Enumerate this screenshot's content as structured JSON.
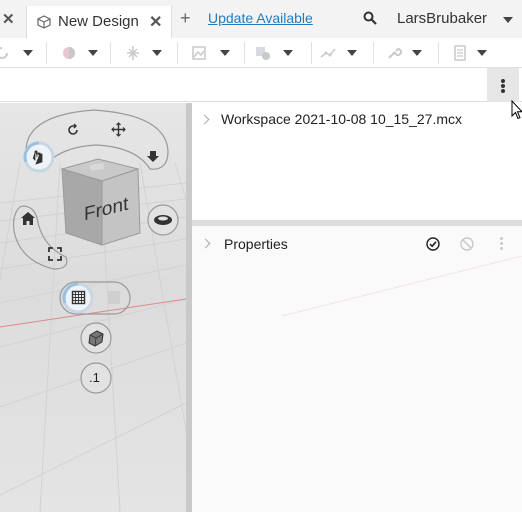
{
  "tabs": {
    "active_label": "New Design",
    "update_link": "Update Available"
  },
  "user": {
    "name": "LarsBrubaker"
  },
  "toolbar": {
    "groups": [
      "rotate-tool",
      "color-tool",
      "align-tool",
      "image-tool",
      "shape-tool",
      "path-tool",
      "wrench-tool",
      "layers-tool"
    ]
  },
  "viewcube": {
    "face_label": "Front",
    "snap_label": ".1"
  },
  "workspace": {
    "title": "Workspace 2021-10-08 10_15_27.mcx"
  },
  "properties": {
    "title": "Properties"
  },
  "colors": {
    "accent": "#1f7dc4",
    "ring": "#9bc0dd",
    "panel_divider": "#dcdcdc"
  }
}
